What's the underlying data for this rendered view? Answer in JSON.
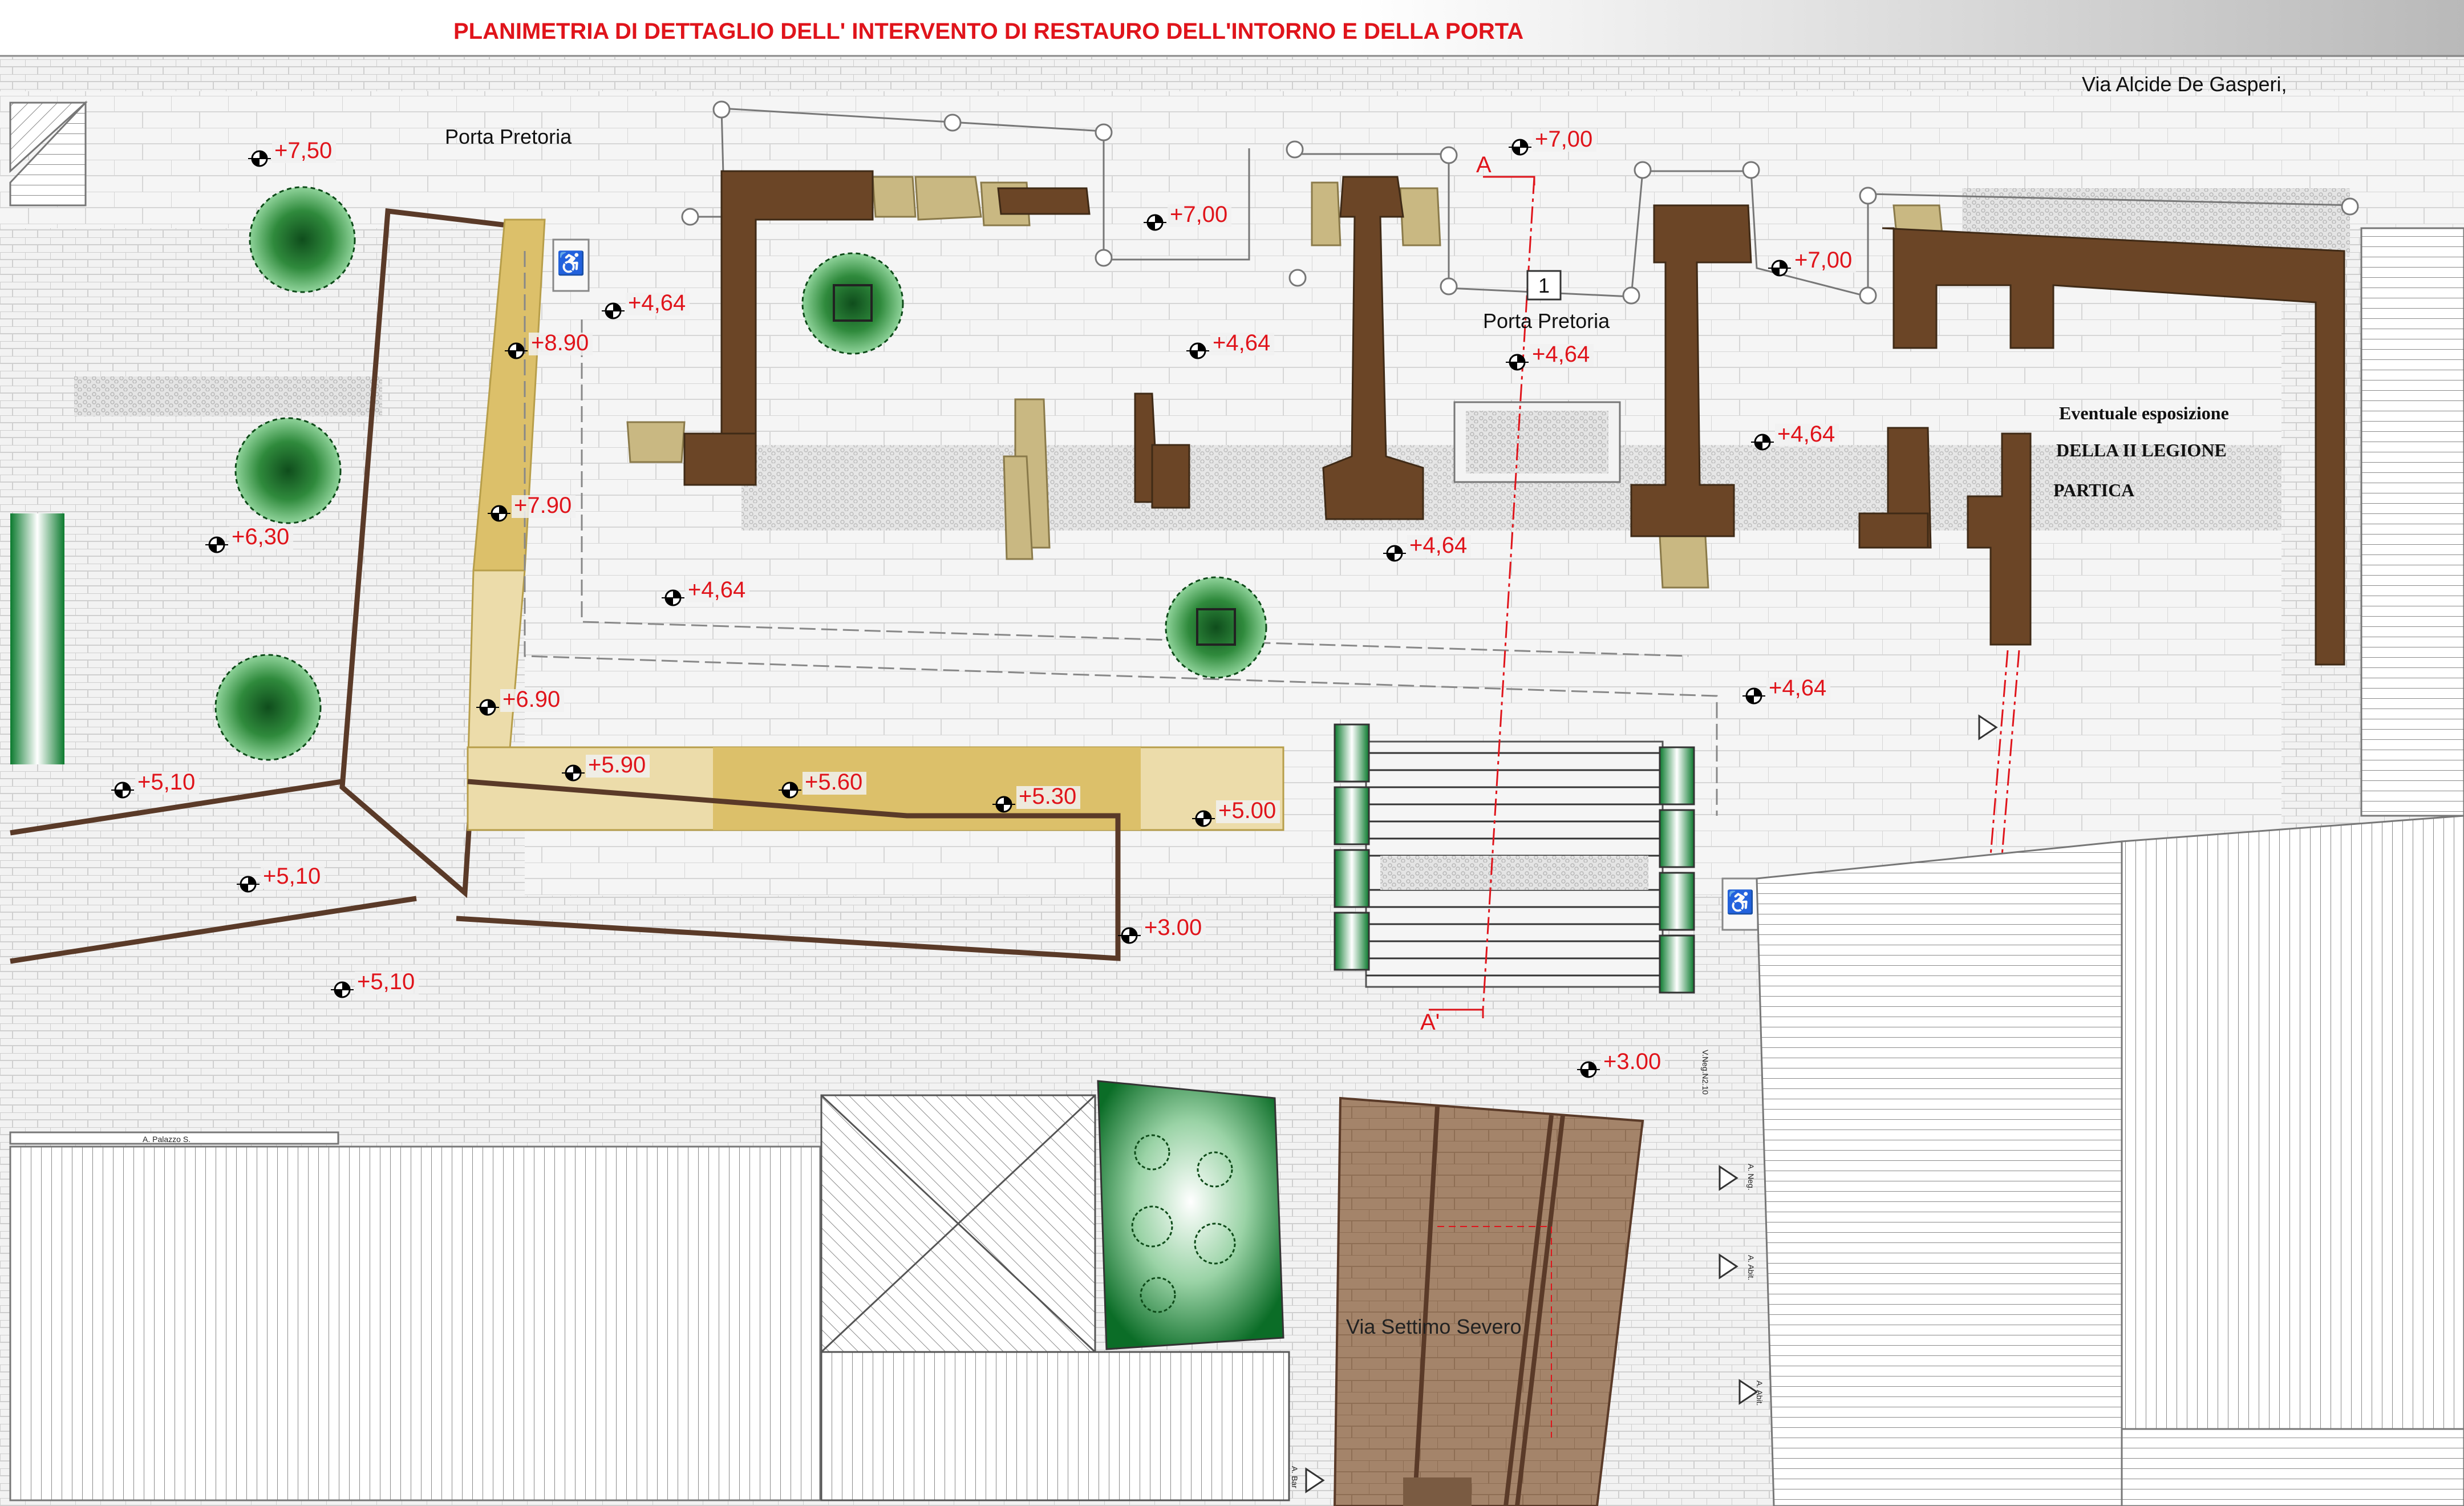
{
  "title": "PLANIMETRIA DI DETTAGLIO  DELL' INTERVENTO DI RESTAURO  DELL'INTORNO E DELLA PORTA",
  "street_labels": {
    "via_de_gasperi": "Via Alcide De Gasperi,",
    "via_settimo_severo": "Via Settimo Severo"
  },
  "porta_label_left": "Porta  Pretoria",
  "porta_label_center": "Porta  Pretoria",
  "section_number": "1",
  "section_marks": {
    "start": "A",
    "end": "A'"
  },
  "exhibition": {
    "line1": "Eventuale esposizione",
    "line2": "DELLA II LEGIONE",
    "line3": "PARTICA"
  },
  "small_labels": {
    "palazzo": "A. Palazzo S.",
    "neg1": "V.Neg.N2.10",
    "neg2": "A. Neg.",
    "abit1": "A. Abit.",
    "abit2": "A. Abit.",
    "bar": "A. Bar"
  },
  "levels": [
    "+7,50",
    "+7,00",
    "+7,00",
    "+7,00",
    "+4,64",
    "+8.90",
    "+4,64",
    "+4,64",
    "+4,64",
    "+7.90",
    "+4,64",
    "+6,30",
    "+4,64",
    "+6.90",
    "+4,64",
    "+5,10",
    "+5.90",
    "+5.60",
    "+5.30",
    "+5.00",
    "+5,10",
    "+3.00",
    "+5,10",
    "+3.00"
  ],
  "colors": {
    "title_red": "#e0141b",
    "wall_brown": "#6b4526",
    "boundary_brown": "#5a3a28",
    "stone_tan": "#c9b882",
    "ramp_gold": "#dcc06a",
    "ramp_light": "#ecdcaa",
    "tree_green": "#2e7d32",
    "street_paving": "#9c7c5c"
  }
}
